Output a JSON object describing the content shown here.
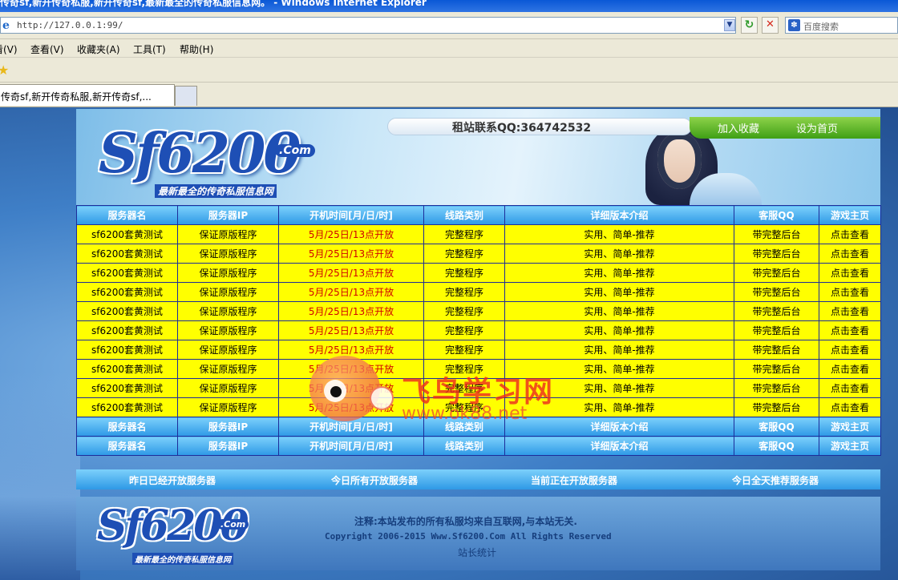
{
  "window": {
    "title": "传奇sf,新开传奇私服,新开传奇sf,最新最全的传奇私服信息网。 - Windows Internet Explorer"
  },
  "address": {
    "url": "http://127.0.0.1:99/",
    "search_placeholder": "百度搜索"
  },
  "menu": [
    "看(V)",
    "查看(V)",
    "收藏夹(A)",
    "工具(T)",
    "帮助(H)"
  ],
  "tab": {
    "label": "传奇sf,新开传奇私服,新开传奇sf,..."
  },
  "banner": {
    "logo_text": "Sf6200",
    "logo_com": ".Com",
    "slogan": "最新最全的传奇私服信息网",
    "contact": "租站联系QQ:364742532",
    "nav": [
      "加入收藏",
      "设为首页"
    ]
  },
  "table": {
    "headers": [
      "服务器名",
      "服务器IP",
      "开机时间[月/日/时]",
      "线路类别",
      "详细版本介绍",
      "客服QQ",
      "游戏主页"
    ],
    "rows": [
      [
        "sf6200套黄测试",
        "保证原版程序",
        "5月/25日/13点开放",
        "完整程序",
        "实用、简单-推荐",
        "带完整后台",
        "点击查看"
      ],
      [
        "sf6200套黄测试",
        "保证原版程序",
        "5月/25日/13点开放",
        "完整程序",
        "实用、简单-推荐",
        "带完整后台",
        "点击查看"
      ],
      [
        "sf6200套黄测试",
        "保证原版程序",
        "5月/25日/13点开放",
        "完整程序",
        "实用、简单-推荐",
        "带完整后台",
        "点击查看"
      ],
      [
        "sf6200套黄测试",
        "保证原版程序",
        "5月/25日/13点开放",
        "完整程序",
        "实用、简单-推荐",
        "带完整后台",
        "点击查看"
      ],
      [
        "sf6200套黄测试",
        "保证原版程序",
        "5月/25日/13点开放",
        "完整程序",
        "实用、简单-推荐",
        "带完整后台",
        "点击查看"
      ],
      [
        "sf6200套黄测试",
        "保证原版程序",
        "5月/25日/13点开放",
        "完整程序",
        "实用、简单-推荐",
        "带完整后台",
        "点击查看"
      ],
      [
        "sf6200套黄测试",
        "保证原版程序",
        "5月/25日/13点开放",
        "完整程序",
        "实用、简单-推荐",
        "带完整后台",
        "点击查看"
      ],
      [
        "sf6200套黄测试",
        "保证原版程序",
        "5月/25日/13点开放",
        "完整程序",
        "实用、简单-推荐",
        "带完整后台",
        "点击查看"
      ],
      [
        "sf6200套黄测试",
        "保证原版程序",
        "5月/25日/13点开放",
        "完整程序",
        "实用、简单-推荐",
        "带完整后台",
        "点击查看"
      ],
      [
        "sf6200套黄测试",
        "保证原版程序",
        "5月/25日/13点开放",
        "完整程序",
        "实用、简单-推荐",
        "带完整后台",
        "点击查看"
      ]
    ]
  },
  "categories": [
    "昨日已经开放服务器",
    "今日所有开放服务器",
    "当前正在开放服务器",
    "今日全天推荐服务器"
  ],
  "footer": {
    "note": "注释:本站发布的所有私服均来自互联网,与本站无关.",
    "copyright": "Copyright 2006-2015 Www.Sf6200.Com All Rights Reserved",
    "stats": "站长统计"
  },
  "watermark": {
    "title": "飞鸟学习网",
    "url": "www.ok88.net"
  },
  "colors": {
    "table_header": "#2e99e6",
    "row_bg": "#ffff00",
    "time_text": "#d00000",
    "nav_green": "#3f9f15"
  }
}
